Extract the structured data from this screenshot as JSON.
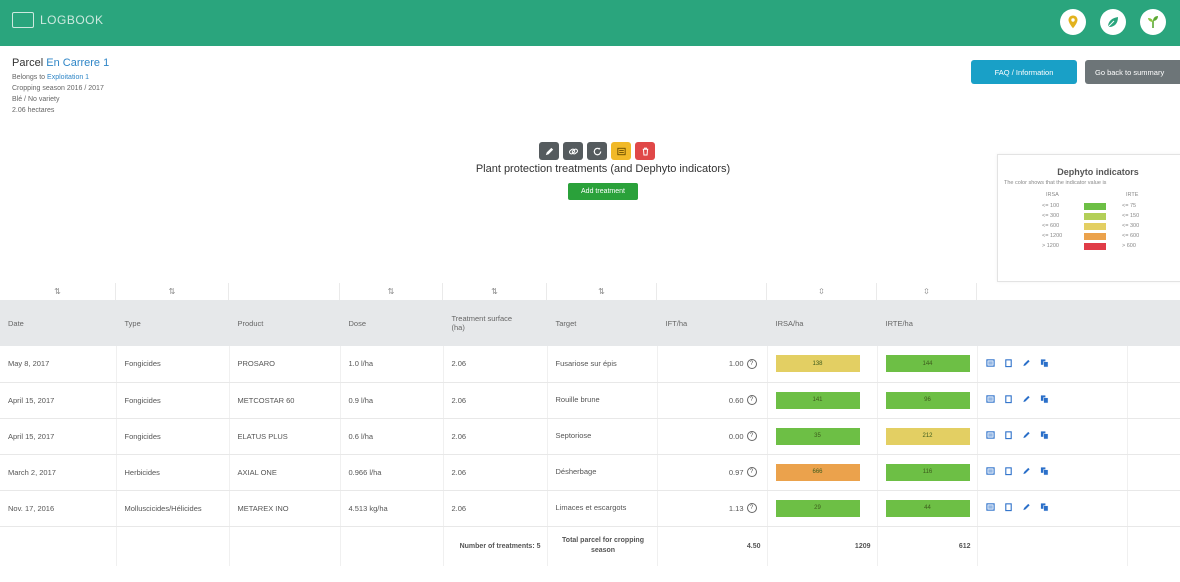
{
  "header": {
    "logo_text": "LOGBOOK",
    "icons": [
      "location-pin-icon",
      "leaf-icon",
      "sprout-icon"
    ],
    "color": "#2aa57d"
  },
  "parcel": {
    "label": "Parcel",
    "name": "En Carrere 1",
    "belongs_label": "Belongs to",
    "belongs_value": "Exploitation 1",
    "season": "Cropping season 2016 / 2017",
    "variety": "Blé / No variety",
    "area": "2.06 hectares"
  },
  "buttons": {
    "faq": "FAQ / Information",
    "back": "Go back to summary",
    "add_treatment": "Add treatment"
  },
  "section_title": "Plant protection treatments (and Dephyto indicators)",
  "legend": {
    "title": "Dephyto indicators",
    "subtitle": "The color shows that the indicator value is",
    "col1": "IRSA",
    "col2": "IRTE",
    "irsa": [
      "<= 100",
      "<= 300",
      "<= 600",
      "<= 1200",
      "> 1200"
    ],
    "irte": [
      "<= 75",
      "<= 150",
      "<= 300",
      "<= 600",
      "> 600"
    ],
    "colors": [
      "#6dbf45",
      "#b3cf58",
      "#e3cf63",
      "#eba24c",
      "#e03c48"
    ]
  },
  "table": {
    "columns": [
      "Date",
      "Type",
      "Product",
      "Dose",
      "Treatment surface (ha)",
      "Target",
      "IFT/ha",
      "IRSA/ha",
      "IRTE/ha"
    ],
    "rows": [
      {
        "date": "May 8, 2017",
        "type": "Fongicides",
        "product": "PROSARO",
        "dose": "1.0 l/ha",
        "surface": "2.06",
        "target": "Fusariose sur épis",
        "ift": "1.00",
        "irsa": "138",
        "irte": "144"
      },
      {
        "date": "April 15, 2017",
        "type": "Fongicides",
        "product": "METCOSTAR 60",
        "dose": "0.9 l/ha",
        "surface": "2.06",
        "target": "Rouille brune",
        "ift": "0.60",
        "irsa": "141",
        "irte": "96"
      },
      {
        "date": "April 15, 2017",
        "type": "Fongicides",
        "product": "ELATUS PLUS",
        "dose": "0.6 l/ha",
        "surface": "2.06",
        "target": "Septoriose",
        "ift": "0.00",
        "irsa": "35",
        "irte": "212"
      },
      {
        "date": "March 2, 2017",
        "type": "Herbicides",
        "product": "AXIAL ONE",
        "dose": "0.966 l/ha",
        "surface": "2.06",
        "target": "Désherbage",
        "ift": "0.97",
        "irsa": "666",
        "irte": "116"
      },
      {
        "date": "Nov. 17, 2016",
        "type": "Molluscicides/Hélicides",
        "product": "METAREX INO",
        "dose": "4.513 kg/ha",
        "surface": "2.06",
        "target": "Limaces et escargots",
        "ift": "1.13",
        "irsa": "29",
        "irte": "44"
      }
    ],
    "footer": {
      "count_label": "Number of treatments: 5",
      "total_label": "Total parcel for cropping season",
      "ift_total": "4.50",
      "irsa_total": "1209",
      "irte_total": "612"
    }
  },
  "bar_colors": {
    "138": "#e3cf63",
    "144": "#6dbf45",
    "141": "#6dbf45",
    "96": "#6dbf45",
    "35": "#6dbf45",
    "212": "#e3cf63",
    "666": "#eba24c",
    "116": "#6dbf45",
    "29": "#6dbf45",
    "44": "#6dbf45"
  },
  "action_icons": [
    "list-icon",
    "copy-icon",
    "edit-icon",
    "duplicate-icon"
  ]
}
